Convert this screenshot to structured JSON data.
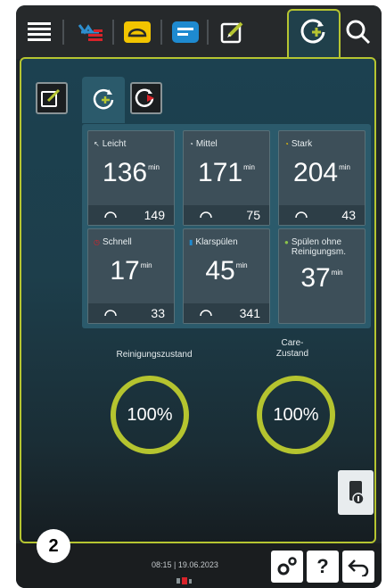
{
  "topbar": {
    "icons": [
      "menu-icon",
      "cooking-methods-icon",
      "bread-icon",
      "list-icon",
      "edit-icon",
      "cleaning-icon",
      "search-icon"
    ]
  },
  "subtabs": [
    "edit-program-icon",
    "cleaning-program-icon",
    "cleaning-start-icon"
  ],
  "programs": [
    {
      "name": "Leicht",
      "duration": "136",
      "unit": "min",
      "count": "149"
    },
    {
      "name": "Mittel",
      "duration": "171",
      "unit": "min",
      "count": "75"
    },
    {
      "name": "Stark",
      "duration": "204",
      "unit": "min",
      "count": "43"
    },
    {
      "name": "Schnell",
      "duration": "17",
      "unit": "min",
      "count": "33"
    },
    {
      "name": "Klarspülen",
      "duration": "45",
      "unit": "min",
      "count": "341"
    },
    {
      "name": "Spülen ohne Reinigungsm.",
      "duration": "37",
      "unit": "min",
      "count": ""
    }
  ],
  "status": {
    "cleaning_label": "Reinigungszustand",
    "cleaning_value": "100%",
    "care_label_line1": "Care-",
    "care_label_line2": "Zustand",
    "care_value": "100%"
  },
  "footer": {
    "badge": "2",
    "datetime": "08:15 | 19.06.2023",
    "help_label": "?"
  },
  "colors": {
    "accent": "#b6c531",
    "background": "#1c4150",
    "card": "#3d4f59"
  }
}
